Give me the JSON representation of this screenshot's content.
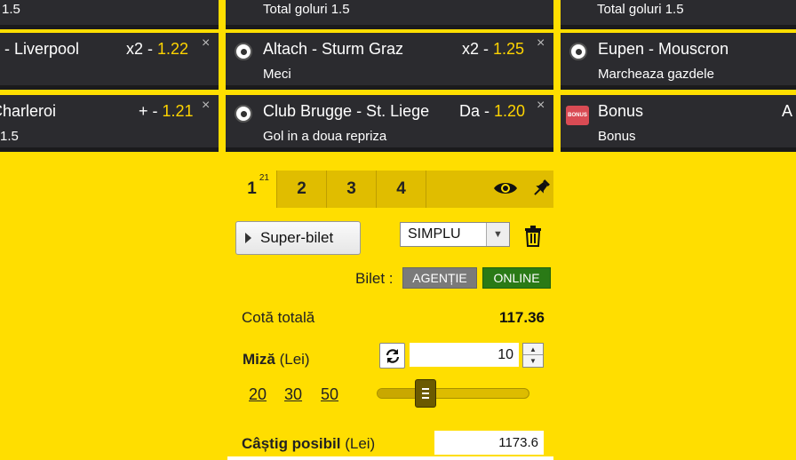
{
  "cards": [
    {
      "title": "",
      "sub": "1.5",
      "odds_prefix": "",
      "odds_value": ""
    },
    {
      "title": "",
      "sub": "Total goluri 1.5",
      "odds_prefix": "",
      "odds_value": ""
    },
    {
      "title": "",
      "sub": "Total goluri 1.5",
      "odds_prefix": "",
      "odds_value": ""
    },
    {
      "title": "n - Liverpool",
      "sub": "",
      "odds_prefix": "x2 - ",
      "odds_value": "1.22"
    },
    {
      "title": "Altach - Sturm Graz",
      "sub": "Meci",
      "odds_prefix": "x2 - ",
      "odds_value": "1.25"
    },
    {
      "title": "Eupen - Mouscron",
      "sub": "Marcheaza gazdele",
      "odds_prefix": "",
      "odds_value": ""
    },
    {
      "title": "Charleroi",
      "sub": "1.5",
      "odds_prefix": "+ - ",
      "odds_value": "1.21"
    },
    {
      "title": "Club Brugge - St. Liege",
      "sub": "Gol in a doua repriza",
      "odds_prefix": "Da - ",
      "odds_value": "1.20"
    },
    {
      "title": "Bonus",
      "sub": "Bonus",
      "odds_prefix": "A",
      "odds_value": ""
    }
  ],
  "close_symbol": "×",
  "bonus_icon_text": "BONUS",
  "tabs": [
    {
      "label": "1",
      "badge": "21"
    },
    {
      "label": "2"
    },
    {
      "label": "3"
    },
    {
      "label": "4"
    }
  ],
  "ticket": {
    "super_bilet": "Super-bilet",
    "type_select": "SIMPLU",
    "bilet_label": "Bilet :",
    "agentie": "AGENȚIE",
    "online": "ONLINE",
    "cota_label": "Cotă totală",
    "cota_value": "117.36",
    "miza_label": "Miză",
    "currency": "(Lei)",
    "miza_value": "10",
    "quick_amounts": [
      "20",
      "30",
      "50"
    ],
    "stake_slider_fraction": 0.29,
    "castig_label": "Câștig posibil",
    "castig_value": "1173.6"
  },
  "colors": {
    "background": "#ffde00",
    "card": "#2b2b2f",
    "odds": "#ffd400",
    "online": "#2a7a16",
    "agentie": "#7a7a7a"
  },
  "icons": [
    "football-icon",
    "bonus-icon",
    "eye-icon",
    "pin-icon",
    "trash-icon",
    "refresh-icon"
  ]
}
